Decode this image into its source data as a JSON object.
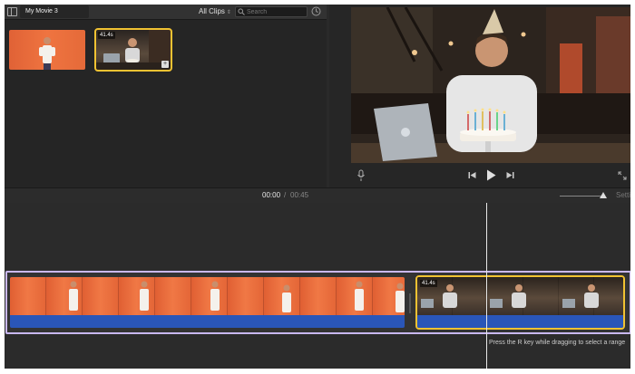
{
  "browser": {
    "project_title": "My Movie 3",
    "filter_label": "All Clips",
    "search_placeholder": "Search",
    "clips": [
      {
        "duration": ""
      },
      {
        "duration": "41.4s"
      }
    ]
  },
  "timebar": {
    "current_time": "00:00",
    "separator": "/",
    "total_time": "00:45",
    "settings_label": "Settings"
  },
  "timeline": {
    "clip2_duration": "41.4s",
    "hint": "Press the R key while dragging to select a range"
  },
  "colors": {
    "accent_yellow": "#f1c232",
    "selection_lavender": "#c9b8f0",
    "audio_blue": "#2a56b8",
    "clip_orange": "#ef7440"
  }
}
